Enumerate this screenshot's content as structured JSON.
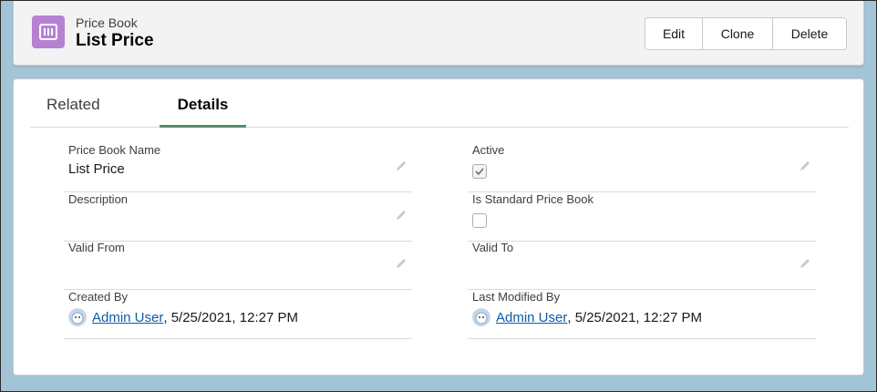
{
  "header": {
    "object_label": "Price Book",
    "record_title": "List Price",
    "icon": "pricebook-icon",
    "icon_color": "#b781d3",
    "buttons": {
      "edit": "Edit",
      "clone": "Clone",
      "delete": "Delete"
    }
  },
  "tabs": [
    {
      "label": "Related",
      "active": false
    },
    {
      "label": "Details",
      "active": true
    }
  ],
  "fields": {
    "price_book_name": {
      "label": "Price Book Name",
      "value": "List Price"
    },
    "active": {
      "label": "Active",
      "checked": true
    },
    "description": {
      "label": "Description",
      "value": ""
    },
    "is_standard": {
      "label": "Is Standard Price Book",
      "checked": false
    },
    "valid_from": {
      "label": "Valid From",
      "value": ""
    },
    "valid_to": {
      "label": "Valid To",
      "value": ""
    },
    "created_by": {
      "label": "Created By",
      "user": "Admin User",
      "timestamp": ", 5/25/2021, 12:27 PM"
    },
    "last_modified_by": {
      "label": "Last Modified By",
      "user": "Admin User",
      "timestamp": ", 5/25/2021, 12:27 PM"
    }
  },
  "colors": {
    "link": "#0b5cab",
    "tab_active_underline": "#5a8a6c",
    "page_background": "#a3c4d6"
  }
}
